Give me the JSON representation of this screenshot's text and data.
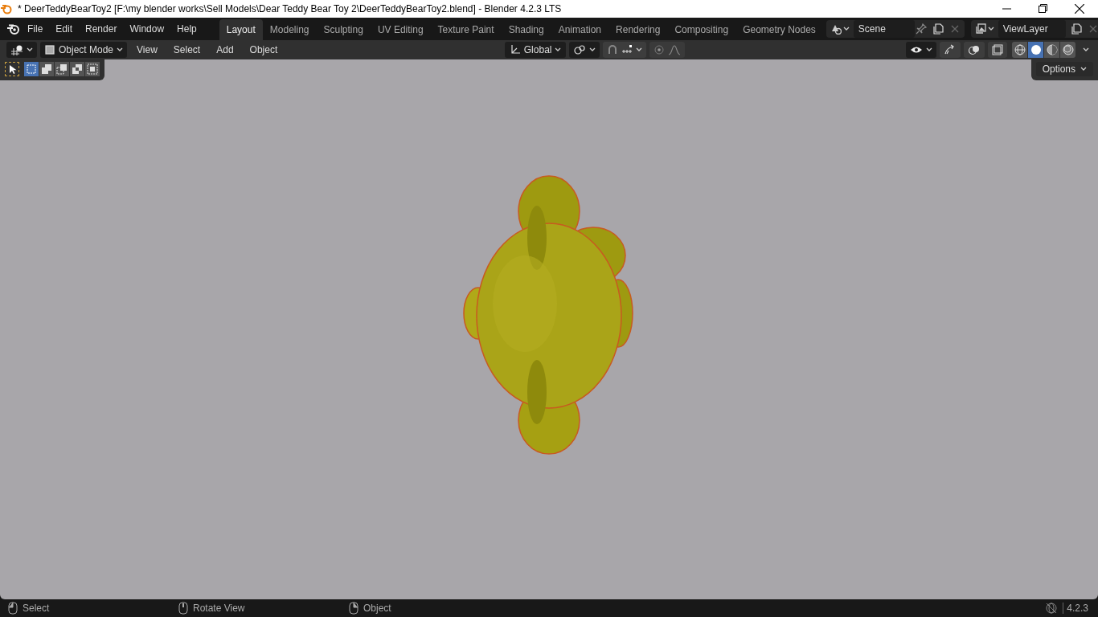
{
  "window": {
    "title": "* DeerTeddyBearToy2 [F:\\my blender works\\Sell Models\\Dear Teddy Bear Toy 2\\DeerTeddyBearToy2.blend] - Blender 4.2.3 LTS"
  },
  "menu": [
    "File",
    "Edit",
    "Render",
    "Window",
    "Help"
  ],
  "workspaces": [
    {
      "label": "Layout",
      "selected": true
    },
    {
      "label": "Modeling",
      "selected": false
    },
    {
      "label": "Sculpting",
      "selected": false
    },
    {
      "label": "UV Editing",
      "selected": false
    },
    {
      "label": "Texture Paint",
      "selected": false
    },
    {
      "label": "Shading",
      "selected": false
    },
    {
      "label": "Animation",
      "selected": false
    },
    {
      "label": "Rendering",
      "selected": false
    },
    {
      "label": "Compositing",
      "selected": false
    },
    {
      "label": "Geometry Nodes",
      "selected": false
    }
  ],
  "scene": "Scene",
  "view_layer": "ViewLayer",
  "header": {
    "mode": "Object Mode",
    "menus": [
      "View",
      "Select",
      "Add",
      "Object"
    ],
    "orientation": "Global",
    "shading": [
      {
        "kind": "wireframe",
        "selected": false
      },
      {
        "kind": "solid",
        "selected": true
      },
      {
        "kind": "material",
        "selected": false
      },
      {
        "kind": "rendered",
        "selected": false
      }
    ]
  },
  "select_modes": [
    {
      "kind": "new",
      "selected": true
    },
    {
      "kind": "extend",
      "selected": false
    },
    {
      "kind": "subtract",
      "selected": false
    },
    {
      "kind": "invert",
      "selected": false
    },
    {
      "kind": "intersect",
      "selected": false
    }
  ],
  "options": "Options",
  "status": [
    {
      "label": "Select"
    },
    {
      "label": "Rotate View"
    },
    {
      "label": "Object"
    }
  ],
  "version": "4.2.3"
}
